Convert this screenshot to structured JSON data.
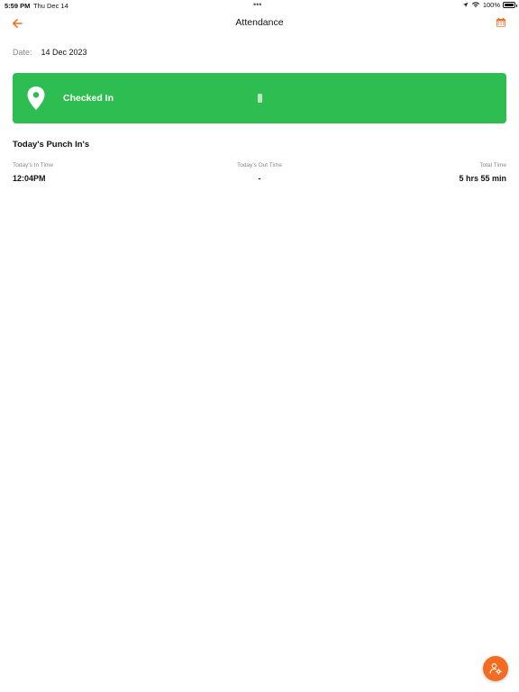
{
  "status_bar": {
    "time": "5:59 PM",
    "date": "Thu Dec 14",
    "dots": "•••",
    "battery": "100%"
  },
  "header": {
    "title": "Attendance",
    "back_icon": "arrow-left-icon",
    "calendar_icon": "calendar-icon"
  },
  "date_row": {
    "label": "Date:",
    "value": "14 Dec 2023"
  },
  "checkin_card": {
    "label": "Checked In",
    "icon": "location-pin-icon",
    "color": "#2ebd50"
  },
  "punch": {
    "section_title": "Today's Punch In's",
    "headers": [
      "Today's In Time",
      "Today's Out Time",
      "Total Time"
    ],
    "values": [
      "12:04PM",
      "-",
      "5 hrs 55 min"
    ]
  },
  "fab": {
    "icon": "user-settings-icon",
    "color": "#f36c21"
  },
  "theme": {
    "accent": "#f36c21"
  }
}
